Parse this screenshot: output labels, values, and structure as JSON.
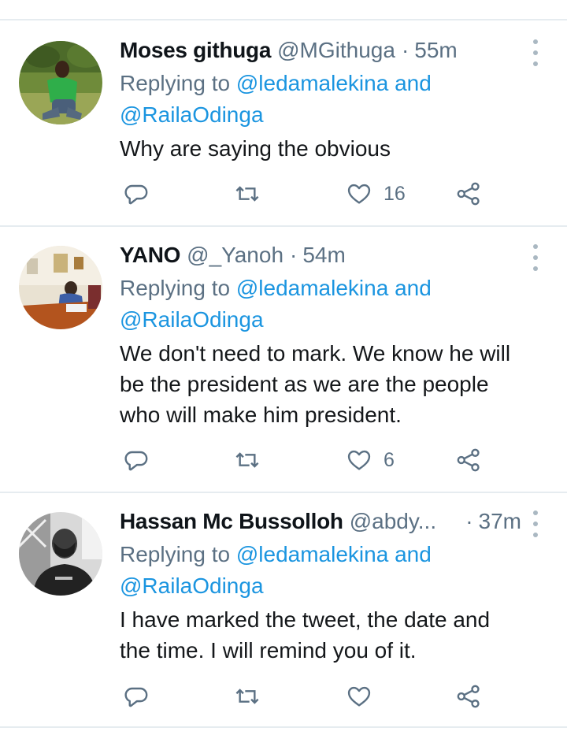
{
  "tweets": [
    {
      "name": "Moses githuga",
      "handle": "@MGithuga",
      "separator": "·",
      "time": "55m",
      "replying_prefix": "Replying to",
      "replying_user1": "@ledamalekina",
      "replying_and": "and",
      "replying_user2": "@RailaOdinga",
      "text_lines": [
        "Why are saying the obvious"
      ],
      "like_count": "16"
    },
    {
      "name": "YANO",
      "handle": "@_Yanoh",
      "separator": "·",
      "time": "54m",
      "replying_prefix": "Replying to",
      "replying_user1": "@ledamalekina",
      "replying_and": "and",
      "replying_user2": "@RailaOdinga",
      "text_lines": [
        "We don't need to mark. We know he will",
        "be the president as we are the people",
        "who will make him president."
      ],
      "like_count": "6"
    },
    {
      "name": "Hassan Mc Bussolloh",
      "handle": "@abdy...",
      "separator": "·",
      "time": "37m",
      "replying_prefix": "Replying to",
      "replying_user1": "@ledamalekina",
      "replying_and": "and",
      "replying_user2": "@RailaOdinga",
      "text_lines": [
        "I have marked the tweet, the date and",
        "the time. I will remind you of it."
      ],
      "like_count": ""
    }
  ],
  "icons": {
    "reply": "reply-icon",
    "retweet": "retweet-icon",
    "like": "like-icon",
    "share": "share-icon",
    "more": "more-vertical-icon"
  },
  "colors": {
    "link": "#1b95e0",
    "secondary_text": "#5b7083",
    "divider": "#e6ecf0"
  }
}
